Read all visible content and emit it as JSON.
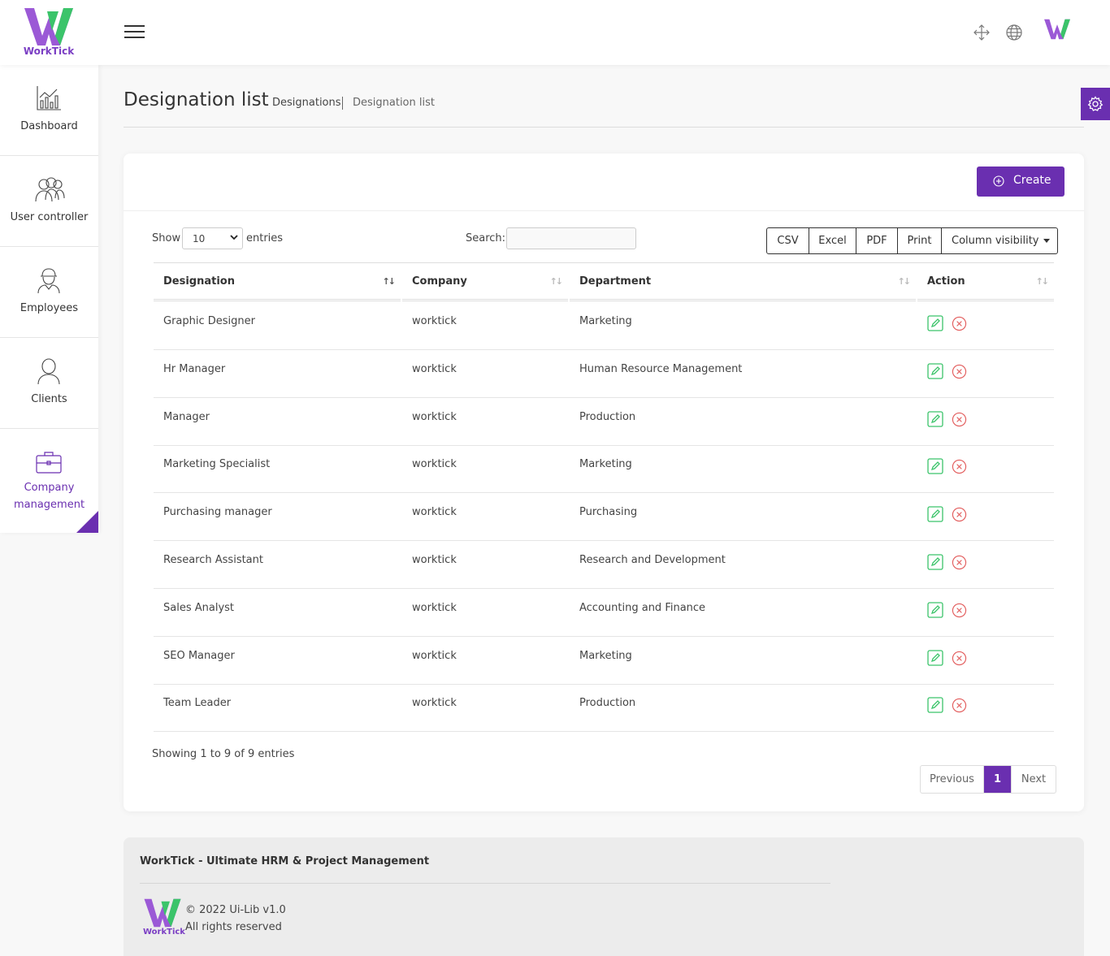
{
  "brand": {
    "name": "WorkTick",
    "accent": "#6a2fb0",
    "green": "#3bc46a"
  },
  "topbar": {
    "menu_icon": "hamburger-icon",
    "fullscreen_icon": "move-icon",
    "language_icon": "globe-icon",
    "avatar_icon": "worktick-avatar"
  },
  "sidebar": {
    "items": [
      {
        "label": "Dashboard",
        "icon": "chart-icon"
      },
      {
        "label": "User controller",
        "icon": "users-icon"
      },
      {
        "label": "Employees",
        "icon": "worker-icon"
      },
      {
        "label": "Clients",
        "icon": "user-icon"
      },
      {
        "label": "Company management",
        "icon": "briefcase-icon"
      }
    ]
  },
  "page": {
    "title": "Designation list",
    "breadcrumb_parent": "Designations",
    "breadcrumb_current": "Designation list"
  },
  "toolbar": {
    "create_label": "Create",
    "show_label": "Show",
    "entries_label": "entries",
    "length_value": "10",
    "search_label": "Search:",
    "search_value": "",
    "buttons": [
      "CSV",
      "Excel",
      "PDF",
      "Print",
      "Column visibility"
    ]
  },
  "table": {
    "columns": [
      "Designation",
      "Company",
      "Department",
      "Action"
    ],
    "rows": [
      {
        "designation": "Graphic Designer",
        "company": "worktick",
        "department": "Marketing"
      },
      {
        "designation": "Hr Manager",
        "company": "worktick",
        "department": "Human Resource Management"
      },
      {
        "designation": "Manager",
        "company": "worktick",
        "department": "Production"
      },
      {
        "designation": "Marketing Specialist",
        "company": "worktick",
        "department": "Marketing"
      },
      {
        "designation": "Purchasing manager",
        "company": "worktick",
        "department": "Purchasing"
      },
      {
        "designation": "Research Assistant",
        "company": "worktick",
        "department": "Research and Development"
      },
      {
        "designation": "Sales Analyst",
        "company": "worktick",
        "department": "Accounting and Finance"
      },
      {
        "designation": "SEO Manager",
        "company": "worktick",
        "department": "Marketing"
      },
      {
        "designation": "Team Leader",
        "company": "worktick",
        "department": "Production"
      }
    ]
  },
  "pagination": {
    "info": "Showing 1 to 9 of 9 entries",
    "previous": "Previous",
    "current": "1",
    "next": "Next"
  },
  "footer": {
    "title": "WorkTick - Ultimate HRM & Project Management",
    "copyright": "© 2022 Ui-Lib v1.0",
    "rights": "All rights reserved"
  }
}
